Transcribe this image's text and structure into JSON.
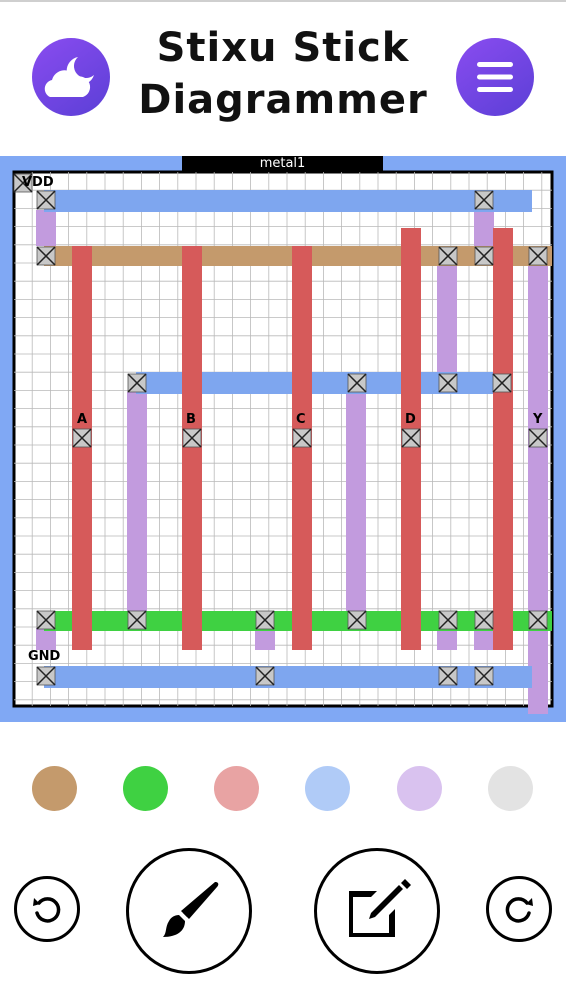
{
  "app": {
    "title_line1": "Stixu Stick",
    "title_line2": "Diagrammer"
  },
  "header": {
    "theme_icon": "moon-cloud-icon",
    "menu_icon": "hamburger-icon"
  },
  "canvas": {
    "active_layer": "metal1",
    "labels": {
      "vdd": "VDD",
      "gnd": "GND",
      "a": "A",
      "b": "B",
      "c": "C",
      "d": "D",
      "y": "Y"
    }
  },
  "colors": {
    "canvas_background": "#80a8f4",
    "metal1": "#7ea6ef",
    "metal2": "#c29bde",
    "poly": "#d65a5a",
    "diffusion_p": "#c49a6c",
    "diffusion_n": "#3fd142",
    "accent": "#6f45e4"
  },
  "palette": {
    "swatches": [
      {
        "name": "p-diffusion",
        "color": "#c49a6c"
      },
      {
        "name": "n-diffusion",
        "color": "#3fd142"
      },
      {
        "name": "polysilicon",
        "color": "#e8a3a3"
      },
      {
        "name": "metal1",
        "color": "#b0cbf7"
      },
      {
        "name": "metal2",
        "color": "#d9c2ef"
      },
      {
        "name": "eraser",
        "color": "#e3e3e3"
      }
    ]
  },
  "toolbar": {
    "undo_icon": "undo-icon",
    "brush_icon": "paintbrush-icon",
    "edit_icon": "edit-icon",
    "redo_icon": "redo-icon"
  }
}
